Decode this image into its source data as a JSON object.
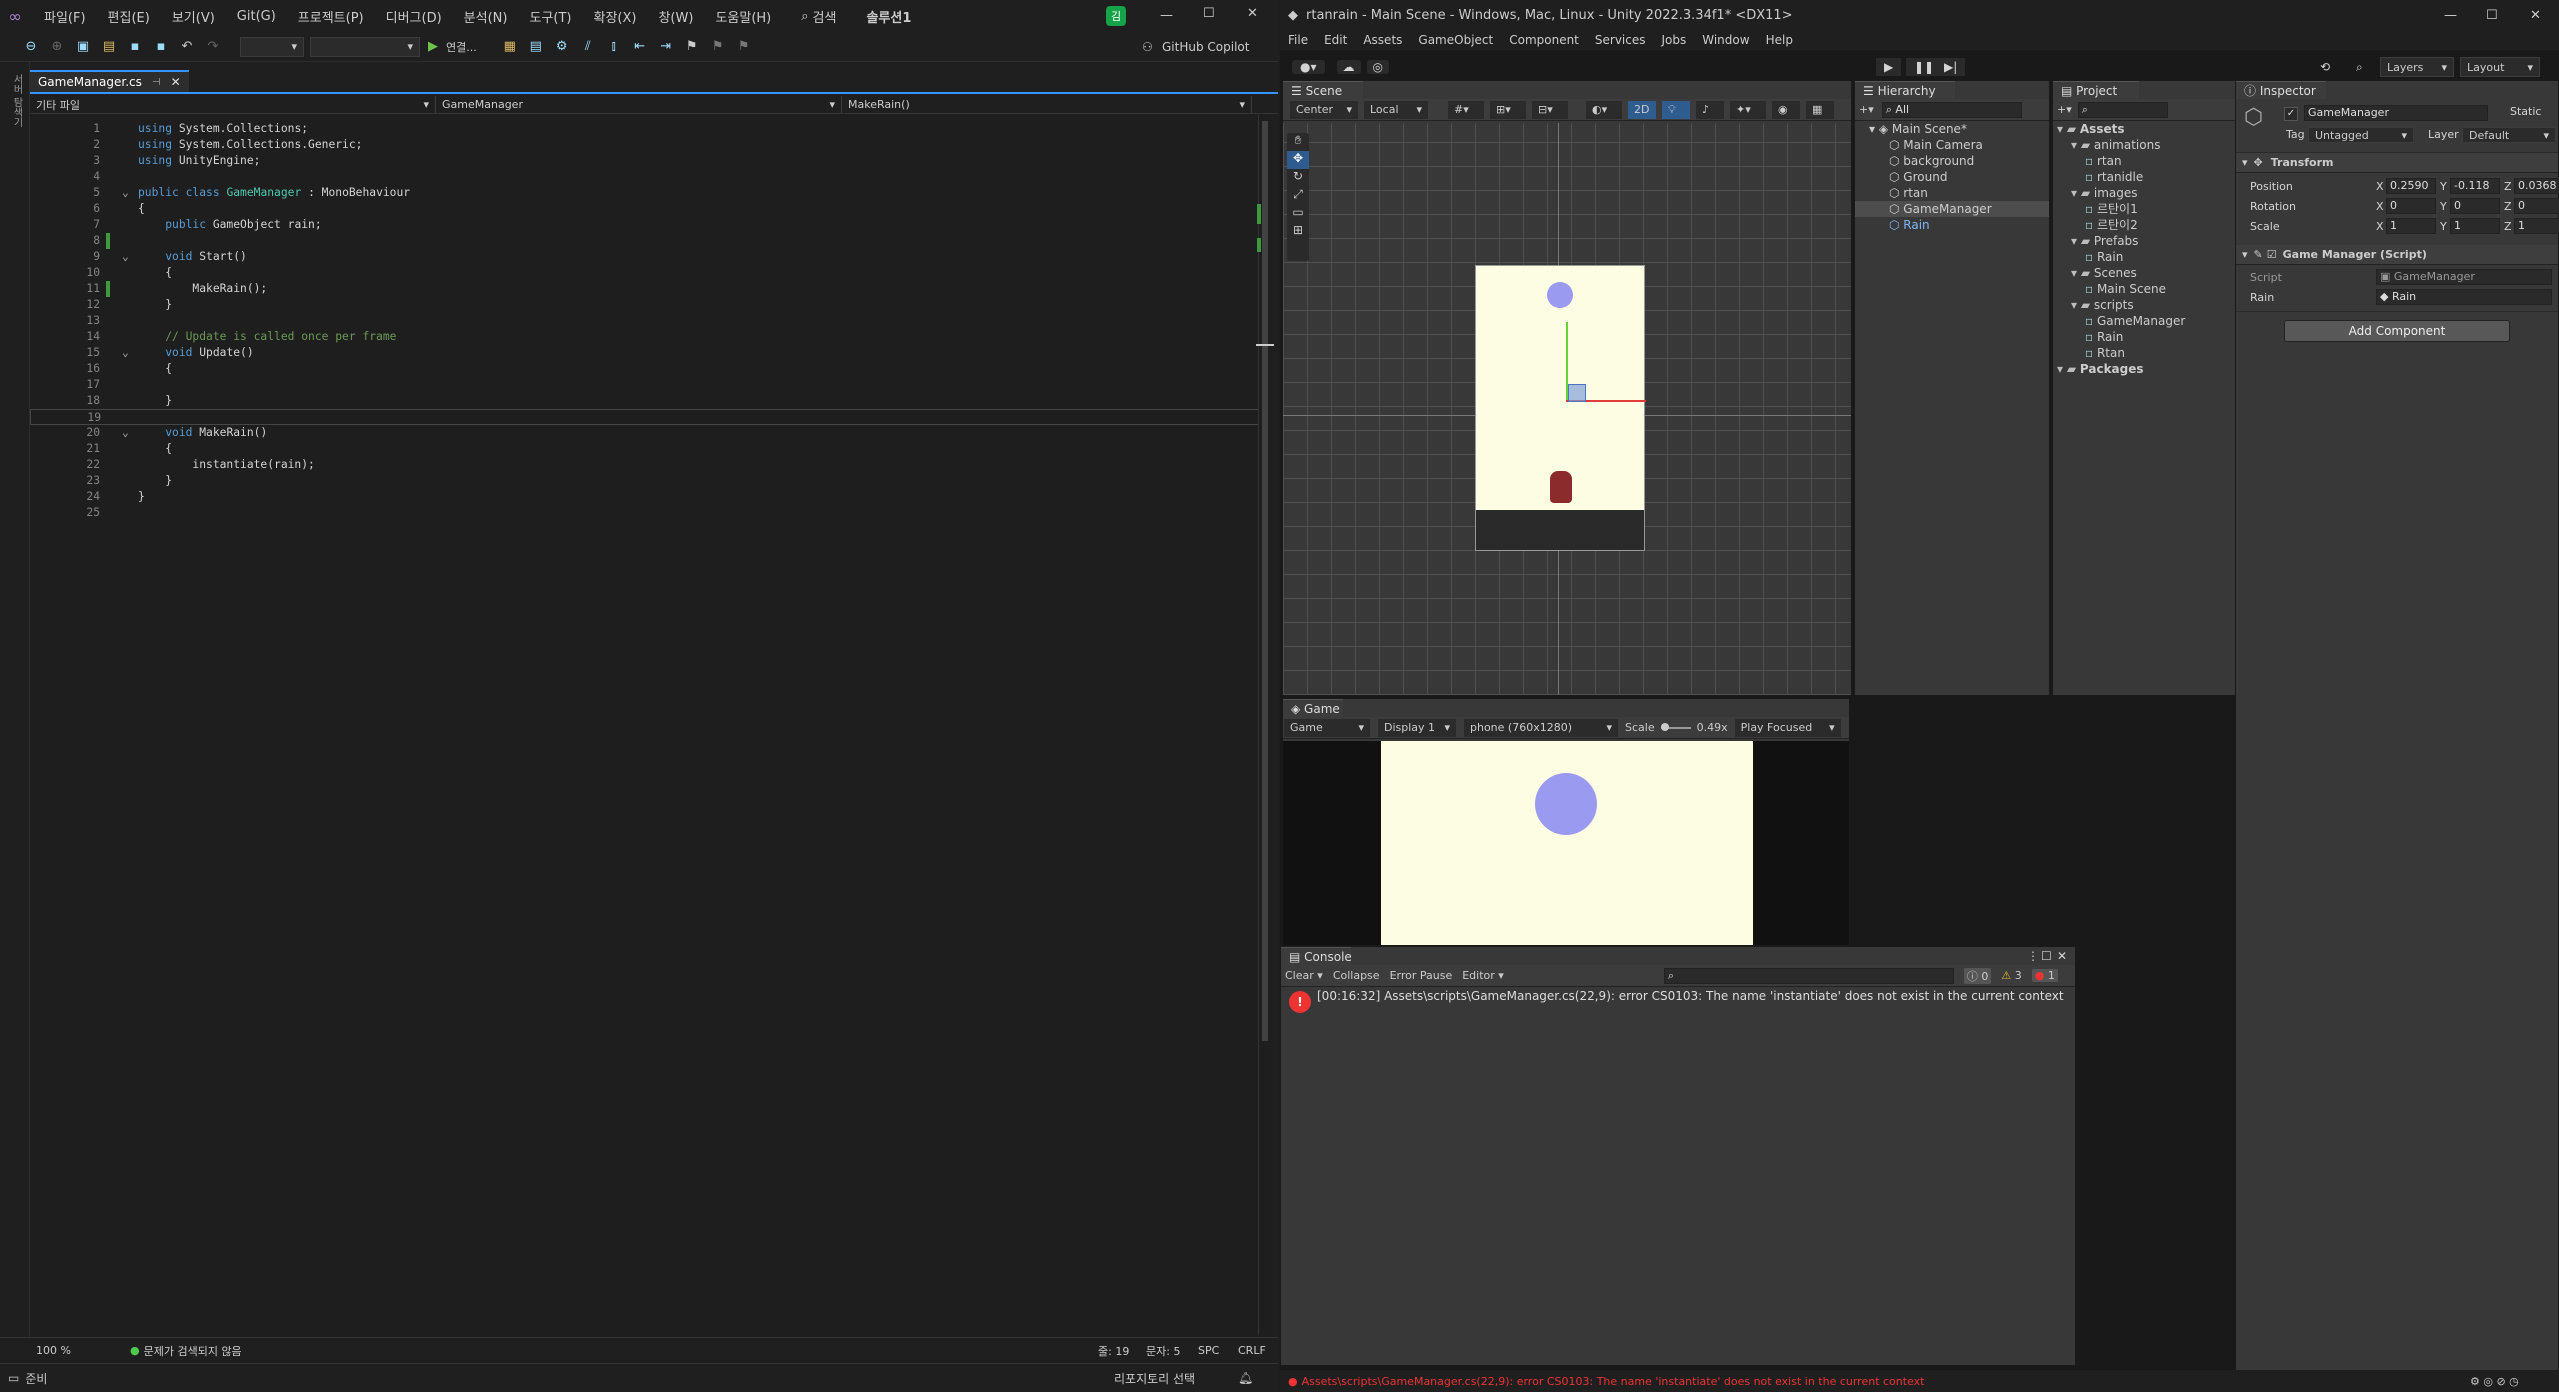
{
  "vs": {
    "menu": [
      "파일(F)",
      "편집(E)",
      "보기(V)",
      "Git(G)",
      "프로젝트(P)",
      "디버그(D)",
      "분석(N)",
      "도구(T)",
      "확장(X)",
      "창(W)",
      "도움말(H)"
    ],
    "search": "검색",
    "solution": "솔루션1",
    "avatar": "김",
    "connect": "연결...",
    "copilot": "GitHub Copilot",
    "tab": "GameManager.cs",
    "nav": {
      "scope": "기타 파일",
      "class": "GameManager",
      "member": "MakeRain()"
    },
    "side_label": "서버 탐색기",
    "code": [
      {
        "n": "1",
        "html": "<span class='kw'>using</span> System.Collections;"
      },
      {
        "n": "2",
        "html": "<span class='kw'>using</span> System.Collections.Generic;"
      },
      {
        "n": "3",
        "html": "<span class='kw'>using</span> UnityEngine;"
      },
      {
        "n": "4",
        "html": ""
      },
      {
        "n": "5",
        "html": "<span class='kw'>public class</span> <span class='ty'>GameManager</span> : MonoBehaviour"
      },
      {
        "n": "6",
        "html": "{"
      },
      {
        "n": "7",
        "html": "    <span class='kw'>public</span> GameObject rain;"
      },
      {
        "n": "8",
        "html": ""
      },
      {
        "n": "9",
        "html": "    <span class='kw'>void</span> Start()"
      },
      {
        "n": "10",
        "html": "    {"
      },
      {
        "n": "11",
        "html": "        MakeRain();"
      },
      {
        "n": "12",
        "html": "    }"
      },
      {
        "n": "13",
        "html": ""
      },
      {
        "n": "14",
        "html": "    <span class='cm'>// Update is called once per frame</span>"
      },
      {
        "n": "15",
        "html": "    <span class='kw'>void</span> Update()"
      },
      {
        "n": "16",
        "html": "    {"
      },
      {
        "n": "17",
        "html": ""
      },
      {
        "n": "18",
        "html": "    }"
      },
      {
        "n": "19",
        "html": ""
      },
      {
        "n": "20",
        "html": "    <span class='kw'>void</span> MakeRain()"
      },
      {
        "n": "21",
        "html": "    {"
      },
      {
        "n": "22",
        "html": "        instantiate(rain);"
      },
      {
        "n": "23",
        "html": "    }"
      },
      {
        "n": "24",
        "html": "}"
      },
      {
        "n": "25",
        "html": ""
      }
    ],
    "status": {
      "zoom": "100 %",
      "issues": "문제가 검색되지 않음",
      "line": "줄: 19",
      "col": "문자: 5",
      "spc": "SPC",
      "crlf": "CRLF"
    },
    "bottom": {
      "ready": "준비",
      "repo": "리포지토리 선택"
    }
  },
  "unity": {
    "title": "rtanrain - Main Scene - Windows, Mac, Linux - Unity 2022.3.34f1* <DX11>",
    "menu": [
      "File",
      "Edit",
      "Assets",
      "GameObject",
      "Component",
      "Services",
      "Jobs",
      "Window",
      "Help"
    ],
    "layers": "Layers",
    "layout": "Layout",
    "scene": {
      "tab": "Scene",
      "pivot": "Center",
      "space": "Local",
      "mode2d": "2D"
    },
    "hierarchy": {
      "tab": "Hierarchy",
      "search": "All",
      "items": [
        {
          "label": "Main Scene*",
          "indent": 0
        },
        {
          "label": "Main Camera",
          "indent": 1
        },
        {
          "label": "background",
          "indent": 1
        },
        {
          "label": "Ground",
          "indent": 1
        },
        {
          "label": "rtan",
          "indent": 1
        },
        {
          "label": "GameManager",
          "indent": 1
        },
        {
          "label": "Rain",
          "indent": 1
        }
      ]
    },
    "project": {
      "tab": "Project",
      "items": [
        {
          "label": "Assets",
          "indent": 0
        },
        {
          "label": "animations",
          "indent": 1
        },
        {
          "label": "rtan",
          "indent": 2
        },
        {
          "label": "rtanidle",
          "indent": 2
        },
        {
          "label": "images",
          "indent": 1
        },
        {
          "label": "르탄이1",
          "indent": 2
        },
        {
          "label": "르탄이2",
          "indent": 2
        },
        {
          "label": "Prefabs",
          "indent": 1
        },
        {
          "label": "Rain",
          "indent": 2
        },
        {
          "label": "Scenes",
          "indent": 1
        },
        {
          "label": "Main Scene",
          "indent": 2
        },
        {
          "label": "scripts",
          "indent": 1
        },
        {
          "label": "GameManager",
          "indent": 2
        },
        {
          "label": "Rain",
          "indent": 2
        },
        {
          "label": "Rtan",
          "indent": 2
        },
        {
          "label": "Packages",
          "indent": 0
        }
      ]
    },
    "inspector": {
      "tab": "Inspector",
      "name": "GameManager",
      "static": "Static",
      "tag_label": "Tag",
      "tag": "Untagged",
      "layer_label": "Layer",
      "layer": "Default",
      "transform": "Transform",
      "position_label": "Position",
      "position": {
        "x": "0.2590",
        "y": "-0.118",
        "z": "0.0368"
      },
      "rotation_label": "Rotation",
      "rotation": {
        "x": "0",
        "y": "0",
        "z": "0"
      },
      "scale_label": "Scale",
      "scale": {
        "x": "1",
        "y": "1",
        "z": "1"
      },
      "component": "Game Manager (Script)",
      "script_label": "Script",
      "script": "GameManager",
      "rain_label": "Rain",
      "rain": "Rain",
      "add": "Add Component"
    },
    "game": {
      "tab": "Game",
      "view": "Game",
      "display": "Display 1",
      "res": "phone (760x1280)",
      "scale_label": "Scale",
      "scale": "0.49x",
      "play": "Play Focused"
    },
    "console": {
      "tab": "Console",
      "clear": "Clear",
      "collapse": "Collapse",
      "errorpause": "Error Pause",
      "editor": "Editor",
      "c0": "0",
      "c1": "3",
      "c2": "1",
      "msg": "[00:16:32] Assets\\scripts\\GameManager.cs(22,9): error CS0103: The name 'instantiate' does not exist in the current context"
    },
    "status": "Assets\\scripts\\GameManager.cs(22,9): error CS0103: The name 'instantiate' does not exist in the current context"
  }
}
